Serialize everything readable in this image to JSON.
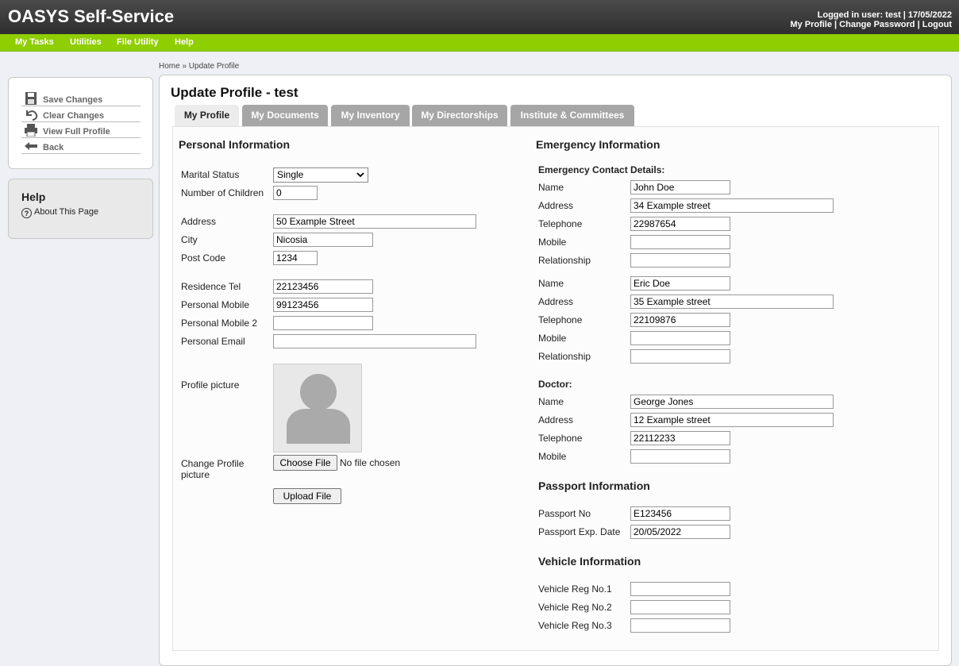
{
  "header": {
    "app_title": "OASYS Self-Service",
    "logged_in": "Logged in user: test | 17/05/2022",
    "my_profile": "My Profile",
    "change_password": "Change Password",
    "logout": "Logout",
    "sep": "|"
  },
  "nav": [
    "My Tasks",
    "Utilities",
    "File Utility",
    "Help"
  ],
  "breadcrumb": "Home » Update Profile",
  "actions": [
    {
      "label": "Save Changes",
      "icon": "save-icon"
    },
    {
      "label": "Clear Changes",
      "icon": "undo-icon"
    },
    {
      "label": "View Full Profile",
      "icon": "printer-icon"
    },
    {
      "label": "Back",
      "icon": "back-arrow-icon"
    }
  ],
  "help": {
    "title": "Help",
    "link": "About This Page"
  },
  "page_title": "Update Profile - test",
  "tabs": [
    "My Profile",
    "My Documents",
    "My Inventory",
    "My Directorships",
    "Institute & Committees"
  ],
  "personal": {
    "title": "Personal Information",
    "marital_label": "Marital Status",
    "marital_value": "Single",
    "children_label": "Number of Children",
    "children_value": "0",
    "address_label": "Address",
    "address_value": "50 Example Street",
    "city_label": "City",
    "city_value": "Nicosia",
    "postcode_label": "Post Code",
    "postcode_value": "1234",
    "restel_label": "Residence Tel",
    "restel_value": "22123456",
    "mobile_label": "Personal Mobile",
    "mobile_value": "99123456",
    "mobile2_label": "Personal Mobile 2",
    "mobile2_value": "",
    "email_label": "Personal Email",
    "email_value": "",
    "picture_label": "Profile picture",
    "change_pic_label_1": "Change Profile",
    "change_pic_label_2": "picture",
    "choose_file": "Choose File",
    "no_file": "No file chosen",
    "upload": "Upload File"
  },
  "emergency": {
    "title": "Emergency Information",
    "contacts_title": "Emergency Contact Details:",
    "labels": {
      "name": "Name",
      "address": "Address",
      "telephone": "Telephone",
      "mobile": "Mobile",
      "relationship": "Relationship"
    },
    "contact1": {
      "name": "John Doe",
      "address": "34 Example street",
      "telephone": "22987654",
      "mobile": "",
      "relationship": ""
    },
    "contact2": {
      "name": "Eric Doe",
      "address": "35 Example street",
      "telephone": "22109876",
      "mobile": "",
      "relationship": ""
    },
    "doctor_title": "Doctor:",
    "doctor": {
      "name": "George Jones",
      "address": "12 Example street",
      "telephone": "22112233",
      "mobile": ""
    }
  },
  "passport": {
    "title": "Passport Information",
    "no_label": "Passport No",
    "no_value": "E123456",
    "exp_label": "Passport Exp. Date",
    "exp_value": "20/05/2022"
  },
  "vehicle": {
    "title": "Vehicle Information",
    "reg1_label": "Vehicle Reg No.1",
    "reg1_value": "",
    "reg2_label": "Vehicle Reg No.2",
    "reg2_value": "",
    "reg3_label": "Vehicle Reg No.3",
    "reg3_value": ""
  }
}
